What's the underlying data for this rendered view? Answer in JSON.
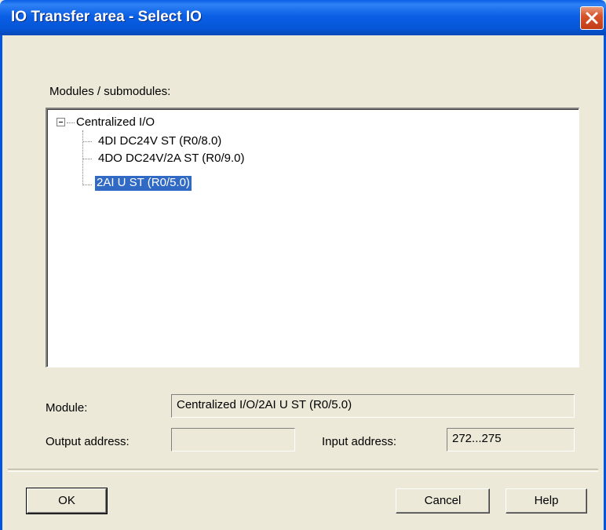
{
  "window": {
    "title": "IO Transfer area - Select IO",
    "close_icon": "close-icon"
  },
  "modules_label": "Modules / submodules:",
  "tree": {
    "root": {
      "label": "Centralized I/O",
      "expander": "−"
    },
    "children": [
      {
        "label": "4DI DC24V ST (R0/8.0)",
        "selected": false
      },
      {
        "label": "4DO DC24V/2A ST (R0/9.0)",
        "selected": false
      },
      {
        "label": "2AI U ST (R0/5.0)",
        "selected": true
      }
    ]
  },
  "fields": {
    "module_label": "Module:",
    "module_value": "Centralized I/O/2AI U ST (R0/5.0)",
    "output_label": "Output address:",
    "output_value": "",
    "input_label": "Input address:",
    "input_value": "272...275"
  },
  "buttons": {
    "ok": "OK",
    "cancel": "Cancel",
    "help": "Help"
  },
  "colors": {
    "titlebar": "#0a5ee6",
    "selection": "#316ac5",
    "dialog_bg": "#ece9d8"
  }
}
